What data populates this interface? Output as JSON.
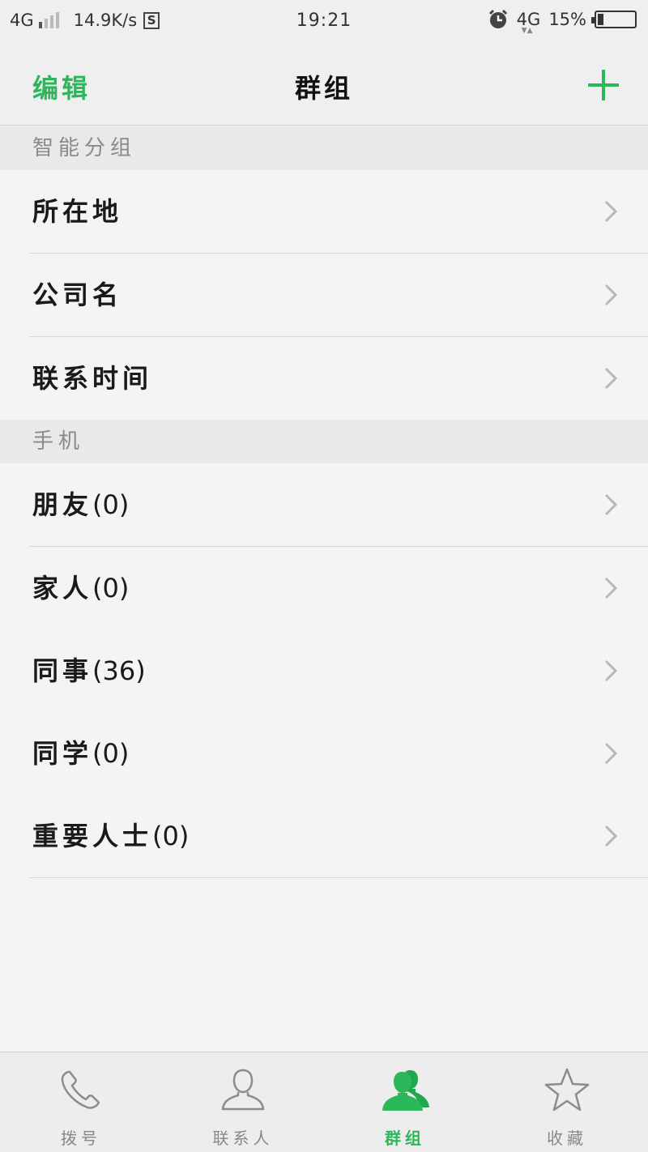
{
  "status_bar": {
    "network_left": "4G",
    "speed": "14.9K/s",
    "s_icon": "S",
    "time": "19:21",
    "network_right": "4G",
    "battery_percent": "15%",
    "battery_level": 0.15
  },
  "header": {
    "edit_label": "编辑",
    "title": "群组",
    "add_icon": "plus-icon",
    "accent_color": "#2cb85a"
  },
  "sections": [
    {
      "title": "智能分组",
      "items": [
        {
          "label": "所在地"
        },
        {
          "label": "公司名"
        },
        {
          "label": "联系时间"
        }
      ]
    },
    {
      "title": "手机",
      "items": [
        {
          "label": "朋友",
          "count": "(0)"
        },
        {
          "label": "家人",
          "count": "(0)"
        },
        {
          "label": "同事",
          "count": "(36)"
        },
        {
          "label": "同学",
          "count": "(0)"
        },
        {
          "label": "重要人士",
          "count": "(0)"
        }
      ]
    }
  ],
  "bottom_nav": [
    {
      "label": "拨号",
      "icon": "phone-icon",
      "active": false
    },
    {
      "label": "联系人",
      "icon": "person-icon",
      "active": false
    },
    {
      "label": "群组",
      "icon": "group-icon",
      "active": true
    },
    {
      "label": "收藏",
      "icon": "star-icon",
      "active": false
    }
  ]
}
